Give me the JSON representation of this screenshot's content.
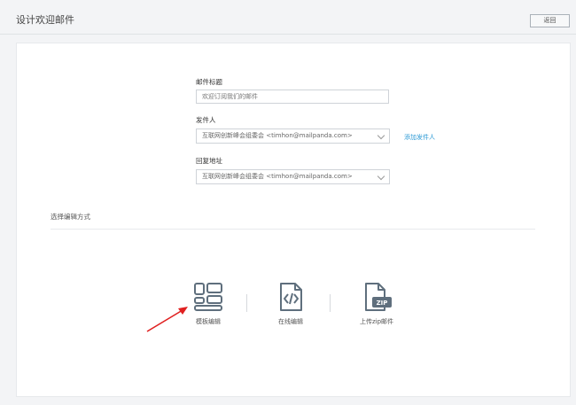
{
  "header": {
    "title": "设计欢迎邮件",
    "back_label": "返回"
  },
  "form": {
    "subject": {
      "label": "邮件标题",
      "value": "欢迎订阅我们的邮件"
    },
    "sender": {
      "label": "发件人",
      "value": "互联网创新峰会组委会 <timhon@mailpanda.com>"
    },
    "add_sender_label": "添加发件人",
    "reply_to": {
      "label": "回复地址",
      "value": "互联网创新峰会组委会 <timhon@mailpanda.com>"
    }
  },
  "editor_section": {
    "title": "选择编辑方式",
    "options": [
      {
        "label": "模板编辑",
        "icon": "template-layout-icon"
      },
      {
        "label": "在线编辑",
        "icon": "code-file-icon"
      },
      {
        "label": "上传zip邮件",
        "icon": "zip-file-icon",
        "icon_text": "ZIP"
      }
    ]
  },
  "colors": {
    "accent_link": "#2f9bd6",
    "icon_stroke": "#5f6f7d",
    "arrow": "#e02020"
  }
}
